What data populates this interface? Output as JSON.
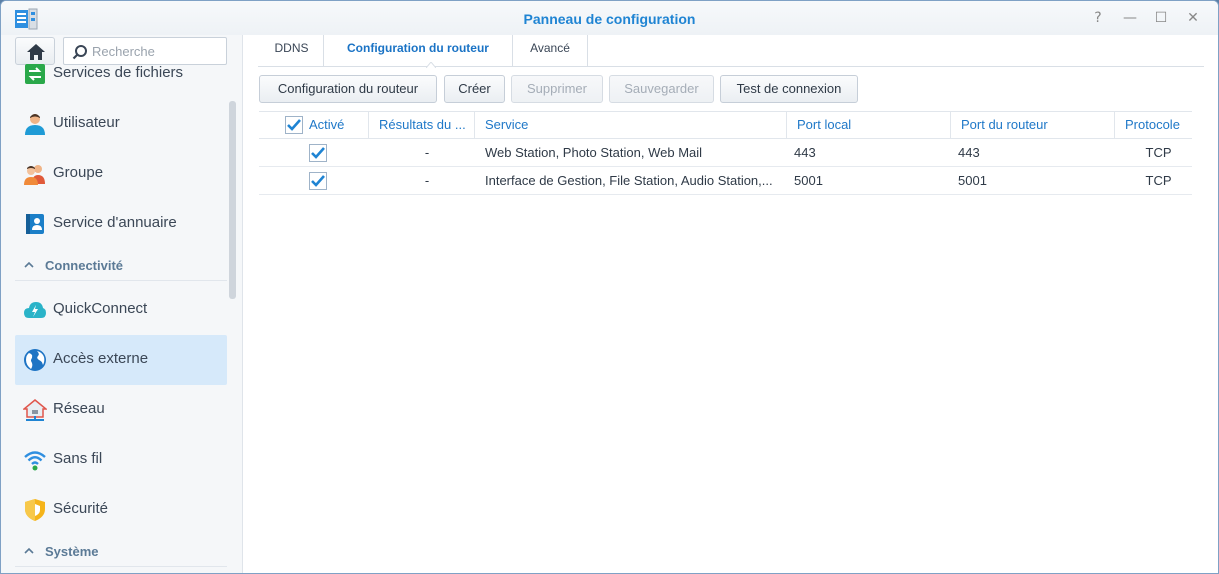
{
  "window": {
    "title": "Panneau de configuration",
    "icons": [
      "app-icon",
      "help-icon",
      "minimize-icon",
      "maximize-icon",
      "close-icon"
    ],
    "help_glyph": "?",
    "minimize_glyph": "—",
    "maximize_glyph": "☐",
    "close_glyph": "✕"
  },
  "sidebar": {
    "search": {
      "placeholder": "Recherche",
      "value": ""
    },
    "items": [
      {
        "label": "Services de fichiers",
        "icon": "file-services-icon"
      },
      {
        "label": "Utilisateur",
        "icon": "user-icon"
      },
      {
        "label": "Groupe",
        "icon": "group-icon"
      },
      {
        "label": "Service d'annuaire",
        "icon": "directory-icon"
      }
    ],
    "section_connectivity": "Connectivité",
    "connectivity_items": [
      {
        "label": "QuickConnect",
        "icon": "quickconnect-icon"
      },
      {
        "label": "Accès externe",
        "icon": "globe-icon",
        "active": true
      },
      {
        "label": "Réseau",
        "icon": "network-icon"
      },
      {
        "label": "Sans fil",
        "icon": "wifi-icon"
      },
      {
        "label": "Sécurité",
        "icon": "shield-icon"
      }
    ],
    "section_system": "Système"
  },
  "tabs": [
    {
      "label": "DDNS"
    },
    {
      "label": "Configuration du routeur",
      "active": true
    },
    {
      "label": "Avancé"
    }
  ],
  "toolbar": {
    "router_config": "Configuration du routeur",
    "create": "Créer",
    "delete": "Supprimer",
    "save": "Sauvegarder",
    "test": "Test de connexion"
  },
  "table": {
    "columns": [
      "Activé",
      "Résultats du ...",
      "Service",
      "Port local",
      "Port du routeur",
      "Protocole"
    ],
    "rows": [
      {
        "enabled": true,
        "result": "-",
        "service": "Web Station, Photo Station, Web Mail",
        "local_port": "443",
        "router_port": "443",
        "protocol": "TCP"
      },
      {
        "enabled": true,
        "result": "-",
        "service": "Interface de Gestion, File Station, Audio Station,...",
        "local_port": "5001",
        "router_port": "5001",
        "protocol": "TCP"
      }
    ]
  },
  "colors": {
    "accent": "#1f84d3",
    "active_item_bg": "#d6e9fa"
  }
}
